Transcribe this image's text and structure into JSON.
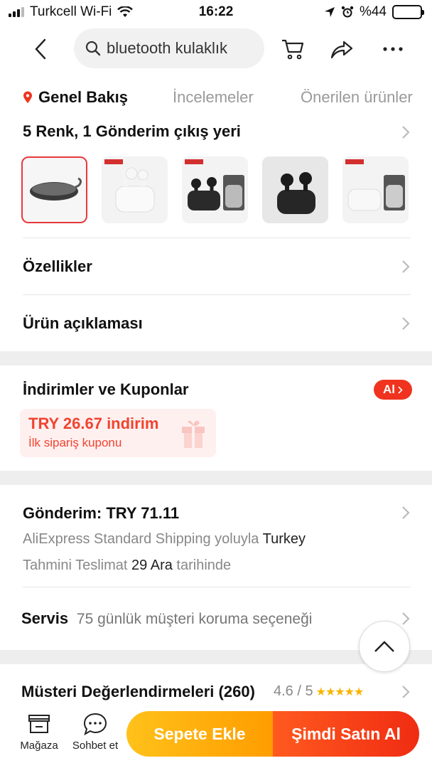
{
  "status_bar": {
    "carrier": "Turkcell Wi-Fi",
    "time": "16:22",
    "battery": "%44",
    "battery_level": 0.44
  },
  "nav": {
    "search_text": "bluetooth kulaklık"
  },
  "tabs": [
    {
      "label": "Genel Bakış",
      "active": true
    },
    {
      "label": "İncelemeler",
      "active": false
    },
    {
      "label": "Önerilen ürünler",
      "active": false
    }
  ],
  "variants": {
    "title": "5 Renk, 1 Gönderim çıkış yeri",
    "selected_index": 0,
    "items": [
      {
        "name": "case"
      },
      {
        "name": "white-earbuds"
      },
      {
        "name": "black-earbuds-gift"
      },
      {
        "name": "black-earbuds"
      },
      {
        "name": "white-case-gift"
      }
    ]
  },
  "rows": {
    "ozellikler": "Özellikler",
    "aciklama": "Ürün açıklaması"
  },
  "coupons": {
    "title": "İndirimler ve Kuponlar",
    "badge": "Al",
    "amount": "TRY 26.67 indirim",
    "subtitle": "İlk sipariş kuponu"
  },
  "shipping": {
    "title": "Gönderim: TRY 71.11",
    "method_prefix": "AliExpress Standard Shipping yoluyla",
    "country": "Turkey",
    "eta_prefix": "Tahmini Teslimat",
    "eta_date": "29 Ara",
    "eta_suffix": "tarihinde"
  },
  "servis": {
    "label": "Servis",
    "text": "75 günlük müşteri koruma seçeneği"
  },
  "reviews": {
    "title": "Müsteri Değerlendirmeleri (260)",
    "rating": "4.6 / 5",
    "stars": "★★★★★"
  },
  "bottom": {
    "store": "Mağaza",
    "chat": "Sohbet et",
    "add_to_cart": "Sepete Ekle",
    "buy_now": "Şimdi Satın Al"
  },
  "colors": {
    "accent": "#f0331e",
    "cart_button": "#ffb30d",
    "coupon_bg": "#fff0f0"
  }
}
